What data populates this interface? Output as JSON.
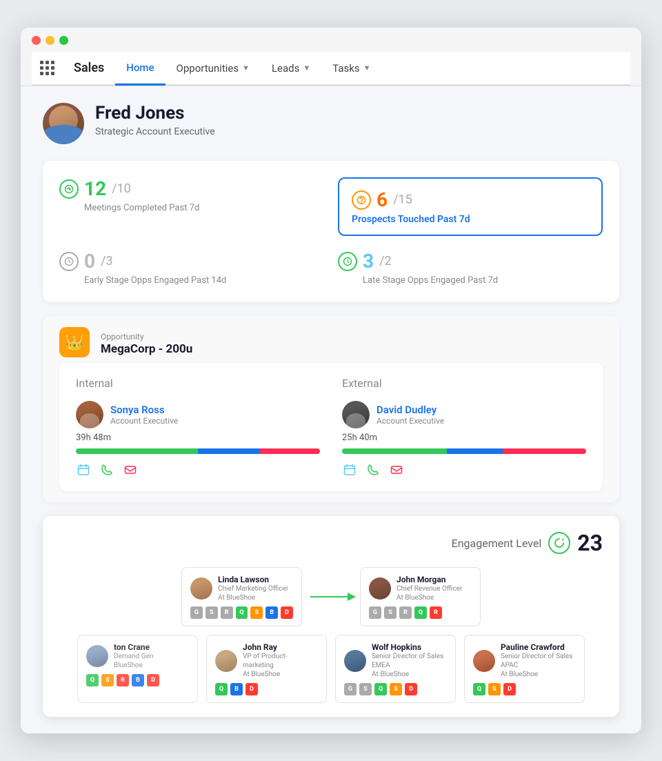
{
  "browser": {
    "dots": [
      "#ff5f57",
      "#ffbd2e",
      "#28c840"
    ]
  },
  "nav": {
    "logo": "Sales",
    "items": [
      {
        "label": "Home",
        "active": true
      },
      {
        "label": "Opportunities",
        "has_dropdown": true
      },
      {
        "label": "Leads",
        "has_dropdown": true
      },
      {
        "label": "Tasks",
        "has_dropdown": true
      }
    ]
  },
  "profile": {
    "name": "Fred Jones",
    "title": "Strategic Account Executive"
  },
  "stats": [
    {
      "icon_type": "green",
      "main_num": "12",
      "main_color": "green",
      "denom": "/10",
      "label": "Meetings Completed Past 7d"
    },
    {
      "icon_type": "orange",
      "main_num": "6",
      "main_color": "orange",
      "denom": "/15",
      "label": "Prospects Touched Past 7d",
      "highlighted": true
    },
    {
      "icon_type": "gray",
      "main_num": "0",
      "main_color": "gray",
      "denom": "/3",
      "label": "Early Stage Opps Engaged Past 14d"
    },
    {
      "icon_type": "green",
      "main_num": "3",
      "main_color": "teal",
      "denom": "/2",
      "label": "Late Stage Opps Engaged Past 7d"
    }
  ],
  "opportunity": {
    "tag": "Opportunity",
    "name": "MegaCorp - 200u"
  },
  "internal": {
    "label": "Internal",
    "person_name": "Sonya Ross",
    "person_role": "Account Executive",
    "time": "39h 48m",
    "avatar_class": "av-sonya"
  },
  "external": {
    "label": "External",
    "person_name": "David Dudley",
    "person_role": "Account Executive",
    "time": "25h 40m",
    "avatar_class": "av-david"
  },
  "action_icons": {
    "calendar": "📅",
    "phone": "📞",
    "mail": "✉"
  },
  "engagement": {
    "label": "Engagement Level",
    "value": "23"
  },
  "org_people": [
    {
      "row": 0,
      "name": "Linda Lawson",
      "title": "Chief Marketing Officer",
      "company": "At BlueShoe",
      "avatar_class": "av-linda",
      "badges": [
        "gray",
        "gray",
        "gray",
        "green",
        "orange",
        "blue",
        "red"
      ]
    },
    {
      "row": 0,
      "name": "John Morgan",
      "title": "Chief Revenue Officer",
      "company": "At BlueShoe",
      "avatar_class": "av-john-m",
      "badges": [
        "gray",
        "gray",
        "gray",
        "green",
        "red"
      ]
    },
    {
      "row": 1,
      "name": "ton Crane",
      "title": "Demand Gen",
      "company": "BlueShoe",
      "avatar_class": "av-ton",
      "badges": [
        "green",
        "orange",
        "red",
        "blue",
        "red"
      ]
    },
    {
      "row": 1,
      "name": "John Ray",
      "title": "VP of Product-marketing",
      "company": "At BlueShoe",
      "avatar_class": "av-john-r",
      "badges": [
        "green",
        "blue",
        "red"
      ]
    },
    {
      "row": 1,
      "name": "Wolf Hopkins",
      "title": "Senior Director of Sales EMEA",
      "company": "At BlueShoe",
      "avatar_class": "av-wolf",
      "badges": [
        "gray",
        "gray",
        "green",
        "orange",
        "red"
      ]
    },
    {
      "row": 1,
      "name": "Pauline Crawford",
      "title": "Senior Director of Sales APAC",
      "company": "At BlueShoe",
      "avatar_class": "av-pauline",
      "badges": [
        "green",
        "orange",
        "red"
      ]
    }
  ]
}
